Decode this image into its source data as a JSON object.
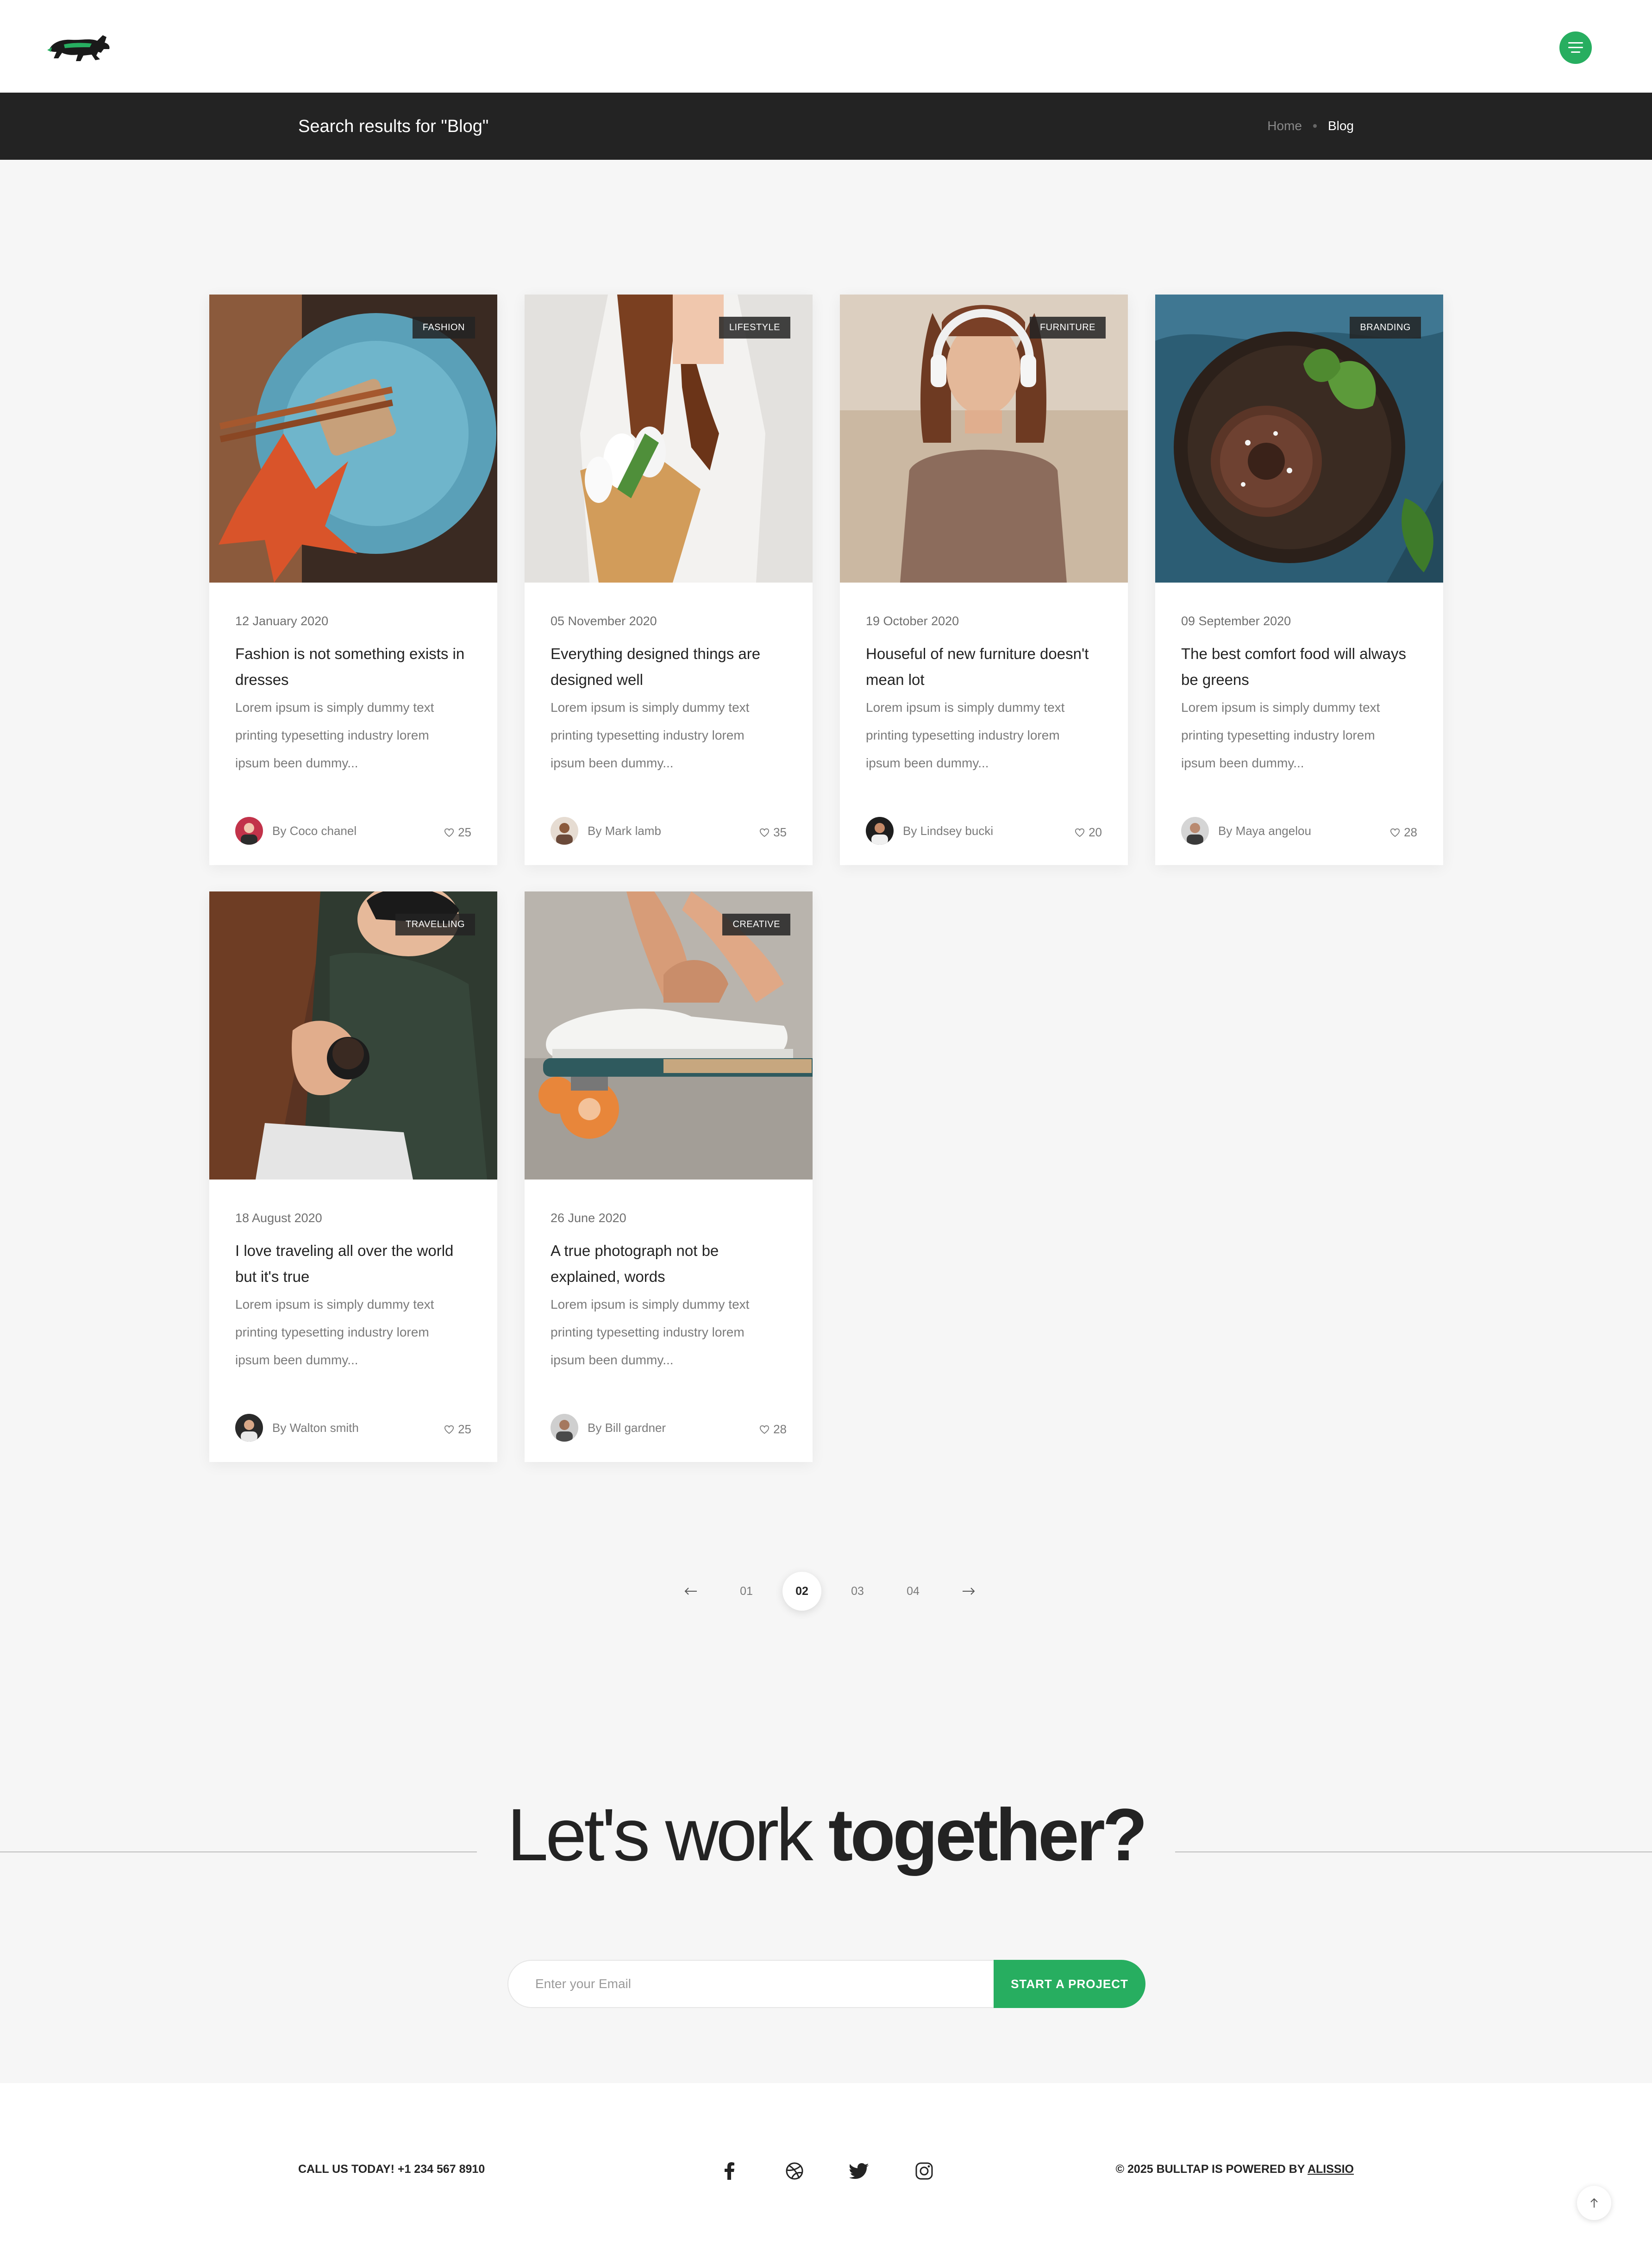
{
  "header": {
    "logo_alt": "Bulltap logo",
    "menu_icon": "hamburger-icon"
  },
  "titlebar": {
    "title": "Search results for \"Blog\"",
    "breadcrumb": {
      "home": "Home",
      "current": "Blog"
    }
  },
  "posts": [
    {
      "tag": "FASHION",
      "date": "12 January 2020",
      "title": "Fashion is not something exists in dresses",
      "excerpt": "Lorem ipsum is simply dummy text printing typesetting industry lorem ipsum been dummy...",
      "author": "By Coco chanel",
      "likes": "25"
    },
    {
      "tag": "LIFESTYLE",
      "date": "05 November 2020",
      "title": "Everything designed things are designed well",
      "excerpt": "Lorem ipsum is simply dummy text printing typesetting industry lorem ipsum been dummy...",
      "author": "By Mark lamb",
      "likes": "35"
    },
    {
      "tag": "FURNITURE",
      "date": "19 October 2020",
      "title": "Houseful of new furniture doesn't mean lot",
      "excerpt": "Lorem ipsum is simply dummy text printing typesetting industry lorem ipsum been dummy...",
      "author": "By Lindsey bucki",
      "likes": "20"
    },
    {
      "tag": "BRANDING",
      "date": "09 September 2020",
      "title": "The best comfort food will always be greens",
      "excerpt": "Lorem ipsum is simply dummy text printing typesetting industry lorem ipsum been dummy...",
      "author": "By Maya angelou",
      "likes": "28"
    },
    {
      "tag": "TRAVELLING",
      "date": "18 August 2020",
      "title": "I love traveling all over the world but it's true",
      "excerpt": "Lorem ipsum is simply dummy text printing typesetting industry lorem ipsum been dummy...",
      "author": "By Walton smith",
      "likes": "25"
    },
    {
      "tag": "CREATIVE",
      "date": "26 June 2020",
      "title": "A true photograph not be explained, words",
      "excerpt": "Lorem ipsum is simply dummy text printing typesetting industry lorem ipsum been dummy...",
      "author": "By Bill gardner",
      "likes": "28"
    }
  ],
  "pagination": {
    "pages": [
      "01",
      "02",
      "03",
      "04"
    ],
    "active": "02"
  },
  "cta": {
    "heading_light": "Let's work ",
    "heading_bold": "together?",
    "email_placeholder": "Enter your Email",
    "button": "START A PROJECT"
  },
  "footer": {
    "call": "CALL US TODAY! +1 234 567 8910",
    "copyright_prefix": "© 2025 BULLTAP IS POWERED BY ",
    "copyright_link": "ALISSIO",
    "social_icons": [
      "facebook-icon",
      "dribbble-icon",
      "twitter-icon",
      "instagram-icon"
    ]
  },
  "colors": {
    "accent": "#27ae60",
    "dark": "#232323",
    "background": "#f6f6f6"
  }
}
